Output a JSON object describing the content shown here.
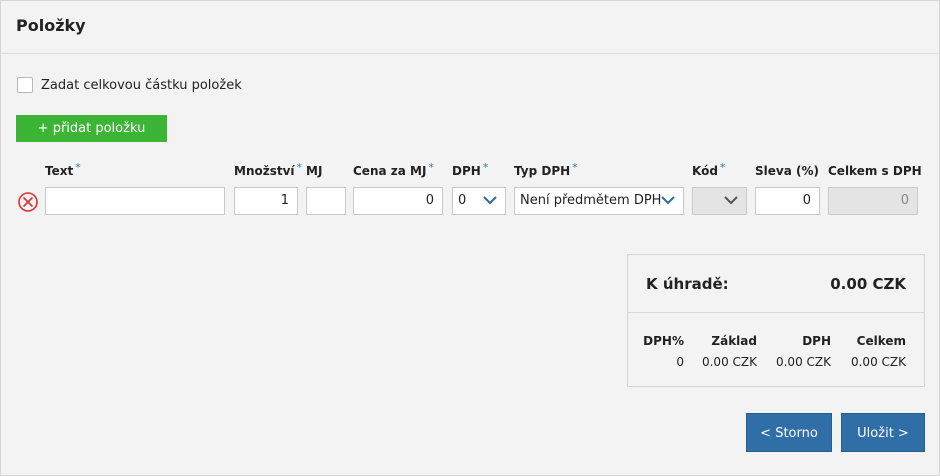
{
  "page": {
    "title": "Položky"
  },
  "total_toggle": {
    "label": "Zadat celkovou částku položek"
  },
  "add_item_button": {
    "label": "+ přidat položku"
  },
  "columns": {
    "text": "Text",
    "quantity": "Množství",
    "unit": "MJ",
    "unit_price": "Cena za MJ",
    "vat": "DPH",
    "vat_type": "Typ DPH",
    "code": "Kód",
    "discount": "Sleva (%)",
    "total_with_vat": "Celkem s DPH"
  },
  "required_marker": "*",
  "item_row": {
    "text": "",
    "quantity": "1",
    "unit": "",
    "unit_price": "0",
    "vat": "0",
    "vat_type": "Není předmětem DPH",
    "code": "",
    "discount": "0",
    "total_with_vat": "0"
  },
  "summary": {
    "label": "K úhradě:",
    "total": "0.00 CZK",
    "vat_table": {
      "headers": [
        "DPH%",
        "Základ",
        "DPH",
        "Celkem"
      ],
      "row": [
        "0",
        "0.00 CZK",
        "0.00 CZK",
        "0.00 CZK"
      ]
    }
  },
  "buttons": {
    "cancel": "< Storno",
    "save": "Uložit >"
  },
  "colors": {
    "add_button": "#3cb536",
    "primary_button": "#2f6ea7",
    "required_marker": "#2a7ab8",
    "remove_icon": "#d9322e"
  }
}
